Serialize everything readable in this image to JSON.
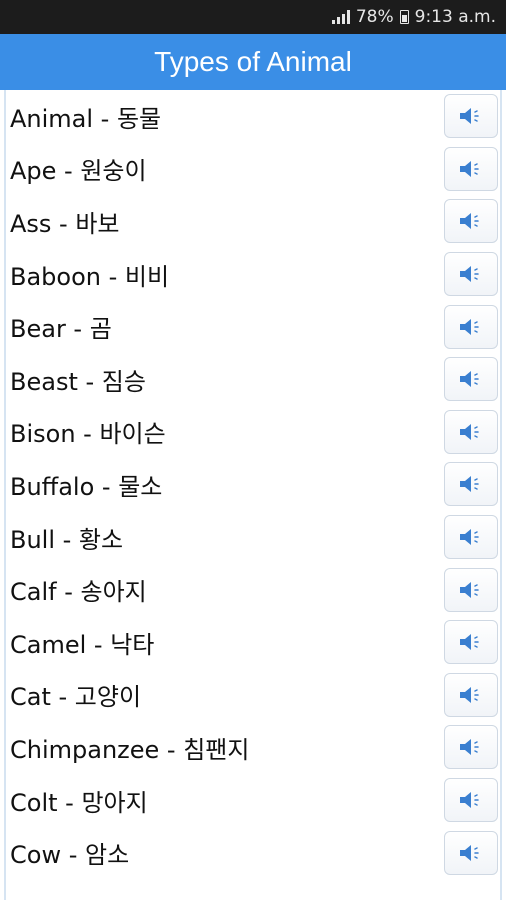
{
  "status": {
    "battery": "78%",
    "time": "9:13 a.m."
  },
  "app_bar": {
    "title": "Types of Animal"
  },
  "icons": {
    "speaker": "speaker-icon",
    "signal": "signal-icon",
    "battery": "battery-icon"
  },
  "colors": {
    "app_bar": "#3a8ee6",
    "speaker": "#3a7fd0"
  },
  "words": [
    {
      "label": " Animal - 동물"
    },
    {
      "label": "Ape - 원숭이"
    },
    {
      "label": "Ass - 바보"
    },
    {
      "label": "Baboon - 비비"
    },
    {
      "label": "Bear - 곰"
    },
    {
      "label": "Beast - 짐승"
    },
    {
      "label": "Bison - 바이슨"
    },
    {
      "label": "Buffalo - 물소"
    },
    {
      "label": "Bull - 황소"
    },
    {
      "label": "Calf - 송아지"
    },
    {
      "label": "Camel - 낙타"
    },
    {
      "label": "Cat - 고양이"
    },
    {
      "label": "Chimpanzee - 침팬지"
    },
    {
      "label": "Colt - 망아지"
    },
    {
      "label": "Cow - 암소"
    }
  ]
}
